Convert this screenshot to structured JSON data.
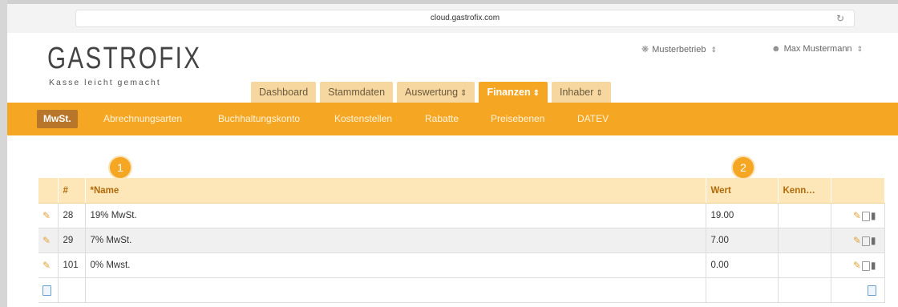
{
  "browser": {
    "url": "cloud.gastrofix.com"
  },
  "header": {
    "logo_title": "GASTROFIX",
    "logo_subtitle": "Kasse leicht gemacht",
    "business_menu": "Musterbetrieb",
    "user_menu": "Max Mustermann"
  },
  "tabs": [
    {
      "label": "Dashboard",
      "dropdown": false,
      "active": false
    },
    {
      "label": "Stammdaten",
      "dropdown": false,
      "active": false
    },
    {
      "label": "Auswertung",
      "dropdown": true,
      "active": false
    },
    {
      "label": "Finanzen",
      "dropdown": true,
      "active": true
    },
    {
      "label": "Inhaber",
      "dropdown": true,
      "active": false
    }
  ],
  "subnav": [
    {
      "label": "MwSt.",
      "active": true
    },
    {
      "label": "Abrechnungsarten",
      "active": false
    },
    {
      "label": "Buchhaltungskonto",
      "active": false
    },
    {
      "label": "Kostenstellen",
      "active": false
    },
    {
      "label": "Rabatte",
      "active": false
    },
    {
      "label": "Preisebenen",
      "active": false
    },
    {
      "label": "DATEV",
      "active": false
    }
  ],
  "badges": [
    "1",
    "2"
  ],
  "table": {
    "columns": [
      "",
      "#",
      "*Name",
      "Wert",
      "Kenn…",
      ""
    ],
    "rows": [
      {
        "id": "28",
        "name": "19% MwSt.",
        "value": "19.00",
        "kenn": ""
      },
      {
        "id": "29",
        "name": "7% MwSt.",
        "value": "7.00",
        "kenn": ""
      },
      {
        "id": "101",
        "name": "0% Mwst.",
        "value": "0.00",
        "kenn": ""
      }
    ]
  },
  "colors": {
    "accent": "#f5a623",
    "tab_inactive": "#f6d79f",
    "subnav_active": "#b8762a",
    "table_header": "#fde6b8"
  },
  "icons": {
    "reload": "reload-icon",
    "home": "home-icon",
    "user": "user-icon",
    "edit": "pencil-icon",
    "copy": "copy-icon",
    "delete": "trash-icon",
    "new": "new-record-icon"
  }
}
